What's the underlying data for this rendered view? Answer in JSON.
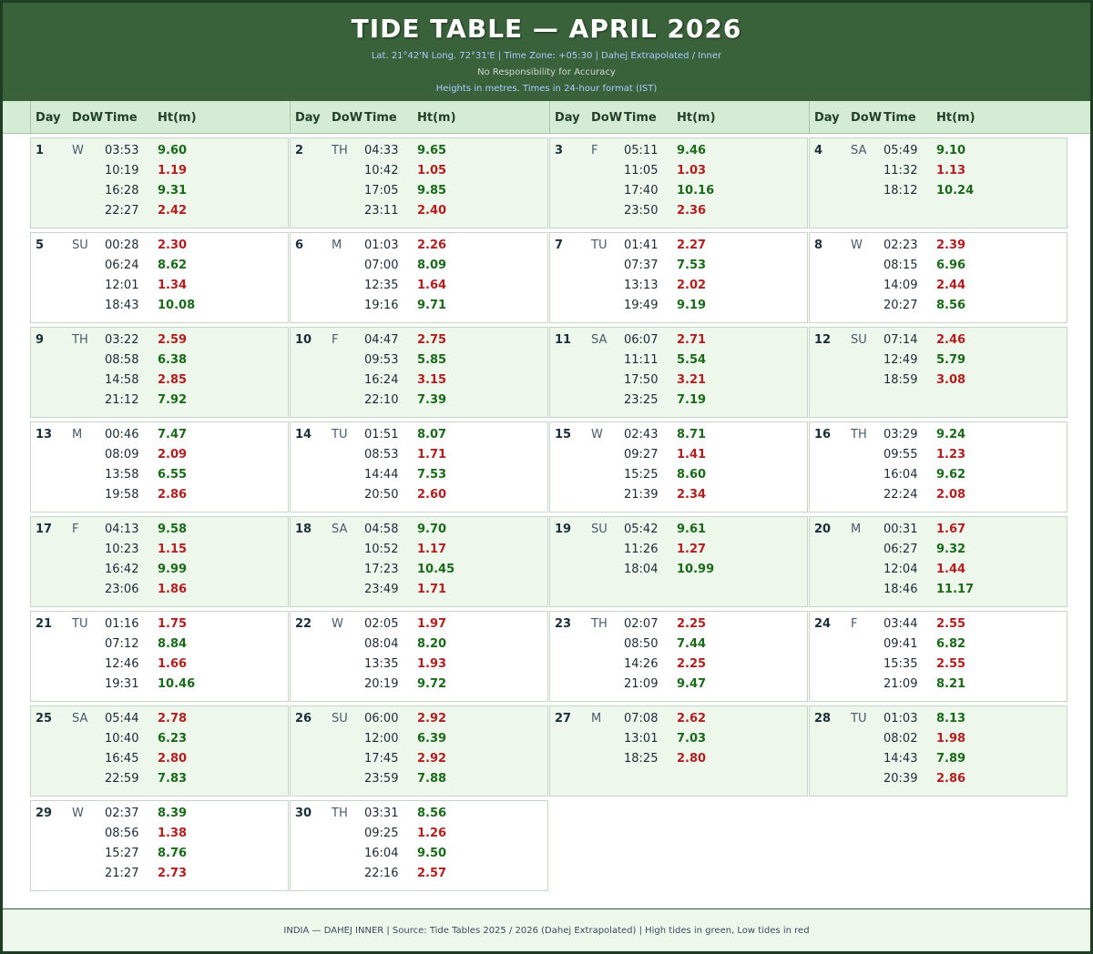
{
  "header": {
    "title": "TIDE TABLE — APRIL 2026",
    "location_line": "Lat. 21°42'N  Long. 72°31'E   |   Time Zone: +05:30   |   Dahej Extrapolated / Inner",
    "disclaimer": "No Responsibility for Accuracy",
    "units_line": "Heights in metres.  Times in 24-hour format (IST)"
  },
  "columns": {
    "day": "Day",
    "dow": "DoW",
    "time": "Time",
    "height": "Ht(m)"
  },
  "colors": {
    "high_tide": "#1a6a1a",
    "low_tide": "#b02020",
    "header_bg": "#3a623a"
  },
  "days": [
    {
      "day": "1",
      "dow": "W",
      "tides": [
        {
          "t": "03:53",
          "h": "9.60",
          "k": "high"
        },
        {
          "t": "10:19",
          "h": "1.19",
          "k": "low"
        },
        {
          "t": "16:28",
          "h": "9.31",
          "k": "high"
        },
        {
          "t": "22:27",
          "h": "2.42",
          "k": "low"
        }
      ]
    },
    {
      "day": "2",
      "dow": "TH",
      "tides": [
        {
          "t": "04:33",
          "h": "9.65",
          "k": "high"
        },
        {
          "t": "10:42",
          "h": "1.05",
          "k": "low"
        },
        {
          "t": "17:05",
          "h": "9.85",
          "k": "high"
        },
        {
          "t": "23:11",
          "h": "2.40",
          "k": "low"
        }
      ]
    },
    {
      "day": "3",
      "dow": "F",
      "tides": [
        {
          "t": "05:11",
          "h": "9.46",
          "k": "high"
        },
        {
          "t": "11:05",
          "h": "1.03",
          "k": "low"
        },
        {
          "t": "17:40",
          "h": "10.16",
          "k": "high"
        },
        {
          "t": "23:50",
          "h": "2.36",
          "k": "low"
        }
      ]
    },
    {
      "day": "4",
      "dow": "SA",
      "tides": [
        {
          "t": "05:49",
          "h": "9.10",
          "k": "high"
        },
        {
          "t": "11:32",
          "h": "1.13",
          "k": "low"
        },
        {
          "t": "18:12",
          "h": "10.24",
          "k": "high"
        }
      ]
    },
    {
      "day": "5",
      "dow": "SU",
      "tides": [
        {
          "t": "00:28",
          "h": "2.30",
          "k": "low"
        },
        {
          "t": "06:24",
          "h": "8.62",
          "k": "high"
        },
        {
          "t": "12:01",
          "h": "1.34",
          "k": "low"
        },
        {
          "t": "18:43",
          "h": "10.08",
          "k": "high"
        }
      ]
    },
    {
      "day": "6",
      "dow": "M",
      "tides": [
        {
          "t": "01:03",
          "h": "2.26",
          "k": "low"
        },
        {
          "t": "07:00",
          "h": "8.09",
          "k": "high"
        },
        {
          "t": "12:35",
          "h": "1.64",
          "k": "low"
        },
        {
          "t": "19:16",
          "h": "9.71",
          "k": "high"
        }
      ]
    },
    {
      "day": "7",
      "dow": "TU",
      "tides": [
        {
          "t": "01:41",
          "h": "2.27",
          "k": "low"
        },
        {
          "t": "07:37",
          "h": "7.53",
          "k": "high"
        },
        {
          "t": "13:13",
          "h": "2.02",
          "k": "low"
        },
        {
          "t": "19:49",
          "h": "9.19",
          "k": "high"
        }
      ]
    },
    {
      "day": "8",
      "dow": "W",
      "tides": [
        {
          "t": "02:23",
          "h": "2.39",
          "k": "low"
        },
        {
          "t": "08:15",
          "h": "6.96",
          "k": "high"
        },
        {
          "t": "14:09",
          "h": "2.44",
          "k": "low"
        },
        {
          "t": "20:27",
          "h": "8.56",
          "k": "high"
        }
      ]
    },
    {
      "day": "9",
      "dow": "TH",
      "tides": [
        {
          "t": "03:22",
          "h": "2.59",
          "k": "low"
        },
        {
          "t": "08:58",
          "h": "6.38",
          "k": "high"
        },
        {
          "t": "14:58",
          "h": "2.85",
          "k": "low"
        },
        {
          "t": "21:12",
          "h": "7.92",
          "k": "high"
        }
      ]
    },
    {
      "day": "10",
      "dow": "F",
      "tides": [
        {
          "t": "04:47",
          "h": "2.75",
          "k": "low"
        },
        {
          "t": "09:53",
          "h": "5.85",
          "k": "high"
        },
        {
          "t": "16:24",
          "h": "3.15",
          "k": "low"
        },
        {
          "t": "22:10",
          "h": "7.39",
          "k": "high"
        }
      ]
    },
    {
      "day": "11",
      "dow": "SA",
      "tides": [
        {
          "t": "06:07",
          "h": "2.71",
          "k": "low"
        },
        {
          "t": "11:11",
          "h": "5.54",
          "k": "high"
        },
        {
          "t": "17:50",
          "h": "3.21",
          "k": "low"
        },
        {
          "t": "23:25",
          "h": "7.19",
          "k": "high"
        }
      ]
    },
    {
      "day": "12",
      "dow": "SU",
      "tides": [
        {
          "t": "07:14",
          "h": "2.46",
          "k": "low"
        },
        {
          "t": "12:49",
          "h": "5.79",
          "k": "high"
        },
        {
          "t": "18:59",
          "h": "3.08",
          "k": "low"
        }
      ]
    },
    {
      "day": "13",
      "dow": "M",
      "tides": [
        {
          "t": "00:46",
          "h": "7.47",
          "k": "high"
        },
        {
          "t": "08:09",
          "h": "2.09",
          "k": "low"
        },
        {
          "t": "13:58",
          "h": "6.55",
          "k": "high"
        },
        {
          "t": "19:58",
          "h": "2.86",
          "k": "low"
        }
      ]
    },
    {
      "day": "14",
      "dow": "TU",
      "tides": [
        {
          "t": "01:51",
          "h": "8.07",
          "k": "high"
        },
        {
          "t": "08:53",
          "h": "1.71",
          "k": "low"
        },
        {
          "t": "14:44",
          "h": "7.53",
          "k": "high"
        },
        {
          "t": "20:50",
          "h": "2.60",
          "k": "low"
        }
      ]
    },
    {
      "day": "15",
      "dow": "W",
      "tides": [
        {
          "t": "02:43",
          "h": "8.71",
          "k": "high"
        },
        {
          "t": "09:27",
          "h": "1.41",
          "k": "low"
        },
        {
          "t": "15:25",
          "h": "8.60",
          "k": "high"
        },
        {
          "t": "21:39",
          "h": "2.34",
          "k": "low"
        }
      ]
    },
    {
      "day": "16",
      "dow": "TH",
      "tides": [
        {
          "t": "03:29",
          "h": "9.24",
          "k": "high"
        },
        {
          "t": "09:55",
          "h": "1.23",
          "k": "low"
        },
        {
          "t": "16:04",
          "h": "9.62",
          "k": "high"
        },
        {
          "t": "22:24",
          "h": "2.08",
          "k": "low"
        }
      ]
    },
    {
      "day": "17",
      "dow": "F",
      "tides": [
        {
          "t": "04:13",
          "h": "9.58",
          "k": "high"
        },
        {
          "t": "10:23",
          "h": "1.15",
          "k": "low"
        },
        {
          "t": "16:42",
          "h": "9.99",
          "k": "high"
        },
        {
          "t": "23:06",
          "h": "1.86",
          "k": "low"
        }
      ]
    },
    {
      "day": "18",
      "dow": "SA",
      "tides": [
        {
          "t": "04:58",
          "h": "9.70",
          "k": "high"
        },
        {
          "t": "10:52",
          "h": "1.17",
          "k": "low"
        },
        {
          "t": "17:23",
          "h": "10.45",
          "k": "high"
        },
        {
          "t": "23:49",
          "h": "1.71",
          "k": "low"
        }
      ]
    },
    {
      "day": "19",
      "dow": "SU",
      "tides": [
        {
          "t": "05:42",
          "h": "9.61",
          "k": "high"
        },
        {
          "t": "11:26",
          "h": "1.27",
          "k": "low"
        },
        {
          "t": "18:04",
          "h": "10.99",
          "k": "high"
        }
      ]
    },
    {
      "day": "20",
      "dow": "M",
      "tides": [
        {
          "t": "00:31",
          "h": "1.67",
          "k": "low"
        },
        {
          "t": "06:27",
          "h": "9.32",
          "k": "high"
        },
        {
          "t": "12:04",
          "h": "1.44",
          "k": "low"
        },
        {
          "t": "18:46",
          "h": "11.17",
          "k": "high"
        }
      ]
    },
    {
      "day": "21",
      "dow": "TU",
      "tides": [
        {
          "t": "01:16",
          "h": "1.75",
          "k": "low"
        },
        {
          "t": "07:12",
          "h": "8.84",
          "k": "high"
        },
        {
          "t": "12:46",
          "h": "1.66",
          "k": "low"
        },
        {
          "t": "19:31",
          "h": "10.46",
          "k": "high"
        }
      ]
    },
    {
      "day": "22",
      "dow": "W",
      "tides": [
        {
          "t": "02:05",
          "h": "1.97",
          "k": "low"
        },
        {
          "t": "08:04",
          "h": "8.20",
          "k": "high"
        },
        {
          "t": "13:35",
          "h": "1.93",
          "k": "low"
        },
        {
          "t": "20:19",
          "h": "9.72",
          "k": "high"
        }
      ]
    },
    {
      "day": "23",
      "dow": "TH",
      "tides": [
        {
          "t": "02:07",
          "h": "2.25",
          "k": "low"
        },
        {
          "t": "08:50",
          "h": "7.44",
          "k": "high"
        },
        {
          "t": "14:26",
          "h": "2.25",
          "k": "low"
        },
        {
          "t": "21:09",
          "h": "9.47",
          "k": "high"
        }
      ]
    },
    {
      "day": "24",
      "dow": "F",
      "tides": [
        {
          "t": "03:44",
          "h": "2.55",
          "k": "low"
        },
        {
          "t": "09:41",
          "h": "6.82",
          "k": "high"
        },
        {
          "t": "15:35",
          "h": "2.55",
          "k": "low"
        },
        {
          "t": "21:09",
          "h": "8.21",
          "k": "high"
        }
      ]
    },
    {
      "day": "25",
      "dow": "SA",
      "tides": [
        {
          "t": "05:44",
          "h": "2.78",
          "k": "low"
        },
        {
          "t": "10:40",
          "h": "6.23",
          "k": "high"
        },
        {
          "t": "16:45",
          "h": "2.80",
          "k": "low"
        },
        {
          "t": "22:59",
          "h": "7.83",
          "k": "high"
        }
      ]
    },
    {
      "day": "26",
      "dow": "SU",
      "tides": [
        {
          "t": "06:00",
          "h": "2.92",
          "k": "low"
        },
        {
          "t": "12:00",
          "h": "6.39",
          "k": "high"
        },
        {
          "t": "17:45",
          "h": "2.92",
          "k": "low"
        },
        {
          "t": "23:59",
          "h": "7.88",
          "k": "high"
        }
      ]
    },
    {
      "day": "27",
      "dow": "M",
      "tides": [
        {
          "t": "07:08",
          "h": "2.62",
          "k": "low"
        },
        {
          "t": "13:01",
          "h": "7.03",
          "k": "high"
        },
        {
          "t": "18:25",
          "h": "2.80",
          "k": "low"
        }
      ]
    },
    {
      "day": "28",
      "dow": "TU",
      "tides": [
        {
          "t": "01:03",
          "h": "8.13",
          "k": "high"
        },
        {
          "t": "08:02",
          "h": "1.98",
          "k": "low"
        },
        {
          "t": "14:43",
          "h": "7.89",
          "k": "high"
        },
        {
          "t": "20:39",
          "h": "2.86",
          "k": "low"
        }
      ]
    },
    {
      "day": "29",
      "dow": "W",
      "tides": [
        {
          "t": "02:37",
          "h": "8.39",
          "k": "high"
        },
        {
          "t": "08:56",
          "h": "1.38",
          "k": "low"
        },
        {
          "t": "15:27",
          "h": "8.76",
          "k": "high"
        },
        {
          "t": "21:27",
          "h": "2.73",
          "k": "low"
        }
      ]
    },
    {
      "day": "30",
      "dow": "TH",
      "tides": [
        {
          "t": "03:31",
          "h": "8.56",
          "k": "high"
        },
        {
          "t": "09:25",
          "h": "1.26",
          "k": "low"
        },
        {
          "t": "16:04",
          "h": "9.50",
          "k": "high"
        },
        {
          "t": "22:16",
          "h": "2.57",
          "k": "low"
        }
      ]
    }
  ],
  "footer": {
    "text": "INDIA — DAHEJ INNER   |   Source: Tide Tables 2025 / 2026 (Dahej Extrapolated)   |   High tides in green, Low tides in red"
  }
}
